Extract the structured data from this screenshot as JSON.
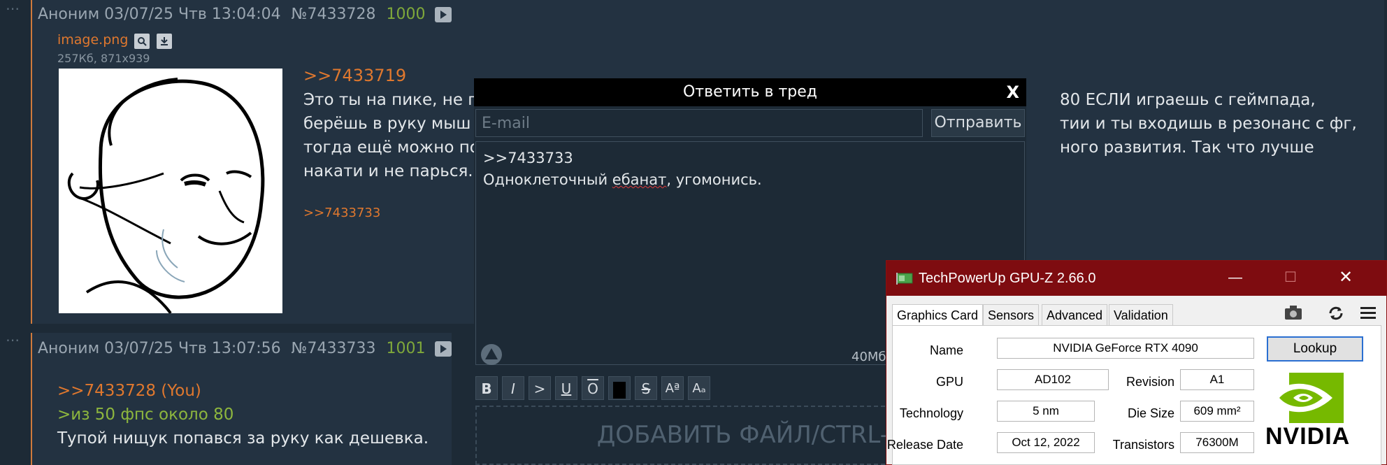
{
  "post1": {
    "author": "Аноним",
    "date": "03/07/25 Чтв 13:04:04",
    "number": "№7433728",
    "count": "1000",
    "file_name": "image.png",
    "file_meta": "257Кб, 871x939",
    "reply_ref": ">>7433719",
    "text_line1": "Это ты на пике, не п",
    "text_line2": "берёшь в руку мыш",
    "text_line3": "тогда ещё можно по",
    "text_line4": "накати и не парься.",
    "text_right1": "80 ЕСЛИ играешь с геймпада,",
    "text_right2": "тии и ты входишь в резонанс с фг,",
    "text_right3": "ного развития. Так что лучше",
    "backlink": ">>7433733"
  },
  "post2": {
    "author": "Аноним",
    "date": "03/07/25 Чтв 13:07:56",
    "number": "№7433733",
    "count": "1001",
    "reply_ref": ">>7433728 (You)",
    "greentext": ">из 50 фпс около 80",
    "text": "Тупой нищук попався за руку как дешевка."
  },
  "reply_form": {
    "title": "Ответить в тред",
    "close": "X",
    "email_placeholder": "E-mail",
    "send_label": "Отправить",
    "message_line1": ">>7433733",
    "message_line2_word1": "Одноклеточный",
    "message_line2_word2": "ебанат",
    "message_line2_rest": ", угомонись.",
    "size_label": "40Мб",
    "format_buttons": [
      "B",
      "I",
      ">",
      "U",
      "O",
      "",
      "S",
      "Aª",
      "Aₐ"
    ],
    "dropzone": "ДОБАВИТЬ ФАЙЛ/CTRL-V"
  },
  "gpuz": {
    "title": "TechPowerUp GPU-Z 2.66.0",
    "tabs": [
      "Graphics Card",
      "Sensors",
      "Advanced",
      "Validation"
    ],
    "labels": {
      "name": "Name",
      "gpu": "GPU",
      "revision": "Revision",
      "technology": "Technology",
      "die_size": "Die Size",
      "release_date": "Release Date",
      "transistors": "Transistors"
    },
    "values": {
      "name": "NVIDIA GeForce RTX 4090",
      "gpu": "AD102",
      "revision": "A1",
      "technology": "5 nm",
      "die_size": "609 mm²",
      "release_date": "Oct 12, 2022",
      "transistors": "76300M"
    },
    "lookup": "Lookup",
    "logo_text": "NVIDIA",
    "accent": "#7e0c10"
  }
}
